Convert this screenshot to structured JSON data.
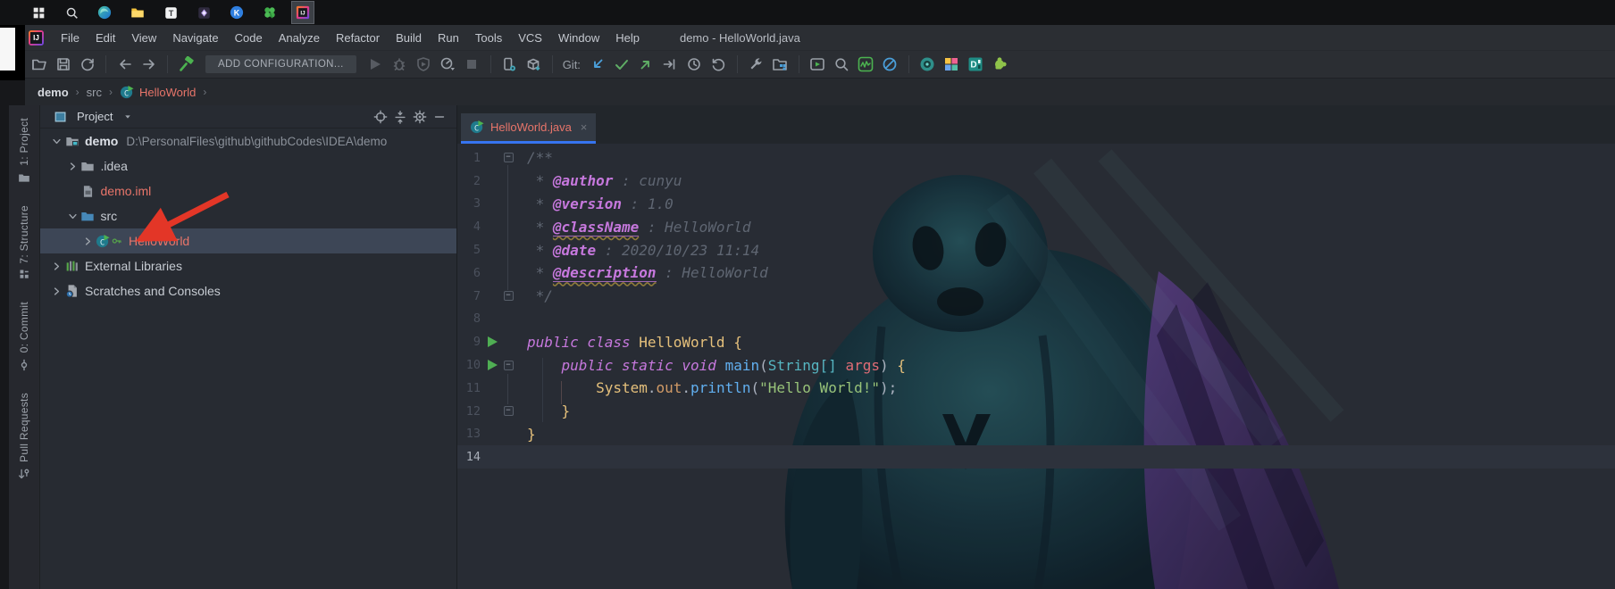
{
  "taskbar": {
    "icons": [
      {
        "name": "windows-start",
        "glyph": "win"
      },
      {
        "name": "taskbar-search",
        "glyph": "search"
      },
      {
        "name": "edge-browser",
        "glyph": "edge"
      },
      {
        "name": "file-explorer",
        "glyph": "folder-yellow"
      },
      {
        "name": "typora-app",
        "glyph": "t-app"
      },
      {
        "name": "dark-app",
        "glyph": "dark-app"
      },
      {
        "name": "keep-app",
        "glyph": "k-app"
      },
      {
        "name": "clover-app",
        "glyph": "clover"
      },
      {
        "name": "intellij-idea",
        "glyph": "idea",
        "active": true
      }
    ]
  },
  "menubar": {
    "logo_text": "IJ",
    "items": [
      "File",
      "Edit",
      "View",
      "Navigate",
      "Code",
      "Analyze",
      "Refactor",
      "Build",
      "Run",
      "Tools",
      "VCS",
      "Window",
      "Help"
    ],
    "window_title": "demo - HelloWorld.java"
  },
  "toolbar": {
    "items": [
      {
        "k": "icon",
        "glyph": "folder-open",
        "name": "open"
      },
      {
        "k": "icon",
        "glyph": "save",
        "name": "save-all"
      },
      {
        "k": "icon",
        "glyph": "sync",
        "name": "synchronize"
      },
      {
        "k": "sep"
      },
      {
        "k": "icon",
        "glyph": "arrow-back",
        "name": "back"
      },
      {
        "k": "icon",
        "glyph": "arrow-forward",
        "name": "forward"
      },
      {
        "k": "sep"
      },
      {
        "k": "icon",
        "glyph": "hammer",
        "name": "build-project"
      },
      {
        "k": "button",
        "label": "ADD CONFIGURATION...",
        "name": "add-configuration"
      },
      {
        "k": "icon",
        "glyph": "run",
        "name": "run",
        "disabled": true
      },
      {
        "k": "icon",
        "glyph": "debug",
        "name": "debug",
        "disabled": true
      },
      {
        "k": "icon",
        "glyph": "coverage",
        "name": "run-with-coverage",
        "disabled": true
      },
      {
        "k": "icon",
        "glyph": "profiler",
        "name": "profiler"
      },
      {
        "k": "icon",
        "glyph": "stop",
        "name": "stop",
        "disabled": true
      },
      {
        "k": "sep"
      },
      {
        "k": "icon",
        "glyph": "attach",
        "name": "attach-to-process"
      },
      {
        "k": "icon",
        "glyph": "package",
        "name": "package-download"
      },
      {
        "k": "sep"
      },
      {
        "k": "label",
        "label": "Git:",
        "name": "git-label"
      },
      {
        "k": "icon",
        "glyph": "git-pull",
        "name": "update-project"
      },
      {
        "k": "icon",
        "glyph": "git-check",
        "name": "commit"
      },
      {
        "k": "icon",
        "glyph": "git-push",
        "name": "push"
      },
      {
        "k": "icon",
        "glyph": "git-cherry",
        "name": "cherry-pick"
      },
      {
        "k": "icon",
        "glyph": "history",
        "name": "show-history"
      },
      {
        "k": "icon",
        "glyph": "rollback",
        "name": "rollback"
      },
      {
        "k": "sep"
      },
      {
        "k": "icon",
        "glyph": "wrench",
        "name": "show-settings"
      },
      {
        "k": "icon",
        "glyph": "modules",
        "name": "project-structure"
      },
      {
        "k": "sep"
      },
      {
        "k": "icon",
        "glyph": "run-anything",
        "name": "run-anything"
      },
      {
        "k": "icon",
        "glyph": "search-everywhere",
        "name": "search-everywhere"
      },
      {
        "k": "icon",
        "glyph": "wakatime",
        "name": "wakatime-plugin"
      },
      {
        "k": "icon",
        "glyph": "zen",
        "name": "zen-mode-plugin"
      },
      {
        "k": "sep"
      },
      {
        "k": "icon",
        "glyph": "plugin-round",
        "name": "plugin-round"
      },
      {
        "k": "icon",
        "glyph": "plugin-squares",
        "name": "material-theme-plugin"
      },
      {
        "k": "icon",
        "glyph": "plugin-d",
        "name": "plugin-d"
      },
      {
        "k": "icon",
        "glyph": "puzzle",
        "name": "plugin-manager"
      }
    ]
  },
  "breadcrumb": {
    "items": [
      {
        "label": "demo",
        "bold": true,
        "name": "breadcrumb-demo"
      },
      {
        "label": "src",
        "name": "breadcrumb-src"
      },
      {
        "label": "HelloWorld",
        "icon": "class-run",
        "color": "#e8756a",
        "name": "breadcrumb-helloworld"
      }
    ]
  },
  "tool_stripe": {
    "items": [
      {
        "label": "1: Project",
        "icon": "stripe-folder",
        "name": "stripe-project",
        "active": true
      },
      {
        "label": "7: Structure",
        "icon": "stripe-structure",
        "name": "stripe-structure"
      },
      {
        "label": "0: Commit",
        "icon": "stripe-commit",
        "name": "stripe-commit"
      },
      {
        "label": "Pull Requests",
        "icon": "stripe-pr",
        "name": "stripe-pull-requests"
      }
    ]
  },
  "project_panel": {
    "title": "Project",
    "tree": [
      {
        "indent": 0,
        "chevron": "down",
        "icon": "project-folder",
        "label": "demo",
        "bold": true,
        "path": "D:\\PersonalFiles\\github\\githubCodes\\IDEA\\demo",
        "name": "tree-demo"
      },
      {
        "indent": 1,
        "chevron": "right",
        "icon": "folder",
        "label": ".idea",
        "name": "tree-idea"
      },
      {
        "indent": 1,
        "chevron": "none",
        "icon": "iml-file",
        "label": "demo.iml",
        "color": "#e8756a",
        "name": "tree-demo-iml"
      },
      {
        "indent": 1,
        "chevron": "down",
        "icon": "src-folder",
        "label": "src",
        "name": "tree-src"
      },
      {
        "indent": 2,
        "chevron": "right",
        "icon": "class-run",
        "badge": "key",
        "label": "HelloWorld",
        "color": "#e8756a",
        "selected": true,
        "name": "tree-helloworld"
      },
      {
        "indent": 0,
        "chevron": "right",
        "icon": "libraries",
        "label": "External Libraries",
        "name": "tree-external-libraries"
      },
      {
        "indent": 0,
        "chevron": "right",
        "icon": "scratches",
        "label": "Scratches and Consoles",
        "name": "tree-scratches"
      }
    ]
  },
  "editor": {
    "tab": {
      "label": "HelloWorld.java"
    },
    "caret_line": 14,
    "lines": [
      {
        "n": 1,
        "fold": "open",
        "tokens": [
          [
            "/**",
            "cm"
          ]
        ]
      },
      {
        "n": 2,
        "tokens": [
          [
            " * ",
            "cm"
          ],
          [
            "@author",
            "tag"
          ],
          [
            " : cunyu",
            "cm"
          ]
        ]
      },
      {
        "n": 3,
        "tokens": [
          [
            " * ",
            "cm"
          ],
          [
            "@version",
            "tag"
          ],
          [
            " : 1.0",
            "cm"
          ]
        ]
      },
      {
        "n": 4,
        "tokens": [
          [
            " * ",
            "cm"
          ],
          [
            "@className",
            "tagw"
          ],
          [
            " : HelloWorld",
            "cm"
          ]
        ]
      },
      {
        "n": 5,
        "tokens": [
          [
            " * ",
            "cm"
          ],
          [
            "@date",
            "tag"
          ],
          [
            " : 2020/10/23 11:14",
            "cm"
          ]
        ]
      },
      {
        "n": 6,
        "tokens": [
          [
            " * ",
            "cm"
          ],
          [
            "@description",
            "tagw"
          ],
          [
            " : HelloWorld",
            "cm"
          ]
        ]
      },
      {
        "n": 7,
        "fold": "end",
        "tokens": [
          [
            " */",
            "cm"
          ]
        ]
      },
      {
        "n": 8,
        "tokens": []
      },
      {
        "n": 9,
        "run": true,
        "tokens": [
          [
            "public class ",
            "kw"
          ],
          [
            "HelloWorld ",
            "cls"
          ],
          [
            "{",
            "br"
          ]
        ]
      },
      {
        "n": 10,
        "run": true,
        "fold": "open",
        "tokens": [
          [
            "    ",
            "pl"
          ],
          [
            "public static void ",
            "kw"
          ],
          [
            "main",
            "fn"
          ],
          [
            "(",
            "pl"
          ],
          [
            "String[]",
            "ty"
          ],
          [
            " ",
            "pl"
          ],
          [
            "args",
            "pr"
          ],
          [
            ") ",
            "pl"
          ],
          [
            "{",
            "br"
          ]
        ]
      },
      {
        "n": 11,
        "tokens": [
          [
            "        ",
            "pl"
          ],
          [
            "System",
            "cls"
          ],
          [
            ".",
            "pl"
          ],
          [
            "out",
            "or"
          ],
          [
            ".",
            "pl"
          ],
          [
            "println",
            "fn"
          ],
          [
            "(",
            "pl"
          ],
          [
            "\"Hello World!\"",
            "st"
          ],
          [
            ")",
            "pl"
          ],
          [
            ";",
            "pl"
          ]
        ]
      },
      {
        "n": 12,
        "fold": "end",
        "tokens": [
          [
            "    ",
            "pl"
          ],
          [
            "}",
            "br"
          ]
        ]
      },
      {
        "n": 13,
        "tokens": [
          [
            "}",
            "br"
          ]
        ]
      },
      {
        "n": 14,
        "tokens": []
      }
    ]
  },
  "colors": {
    "tab_underline": "#3674f0",
    "unversioned_file": "#e8756a",
    "selection_row": "#3d4656",
    "caret_line": "#2d323c",
    "run_arrow": "#4fae53",
    "annotation_arrow": "#e33627",
    "keyword": "#c678dd",
    "class_name": "#e5c07b",
    "function": "#61afef",
    "string": "#98c379",
    "comment": "#5f6672"
  }
}
